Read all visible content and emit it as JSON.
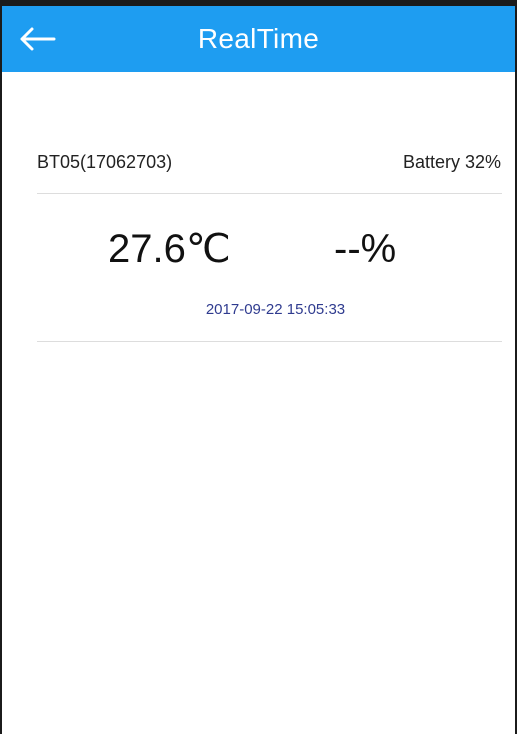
{
  "header": {
    "title": "RealTime",
    "back_icon": "arrow-left-icon",
    "background_color": "#1e9df1"
  },
  "device": {
    "name": "BT05(17062703)",
    "battery": "Battery 32%"
  },
  "reading": {
    "temperature": "27.6℃",
    "humidity": "--%",
    "timestamp": "2017-09-22 15:05:33",
    "timestamp_color": "#2f3b8f"
  }
}
